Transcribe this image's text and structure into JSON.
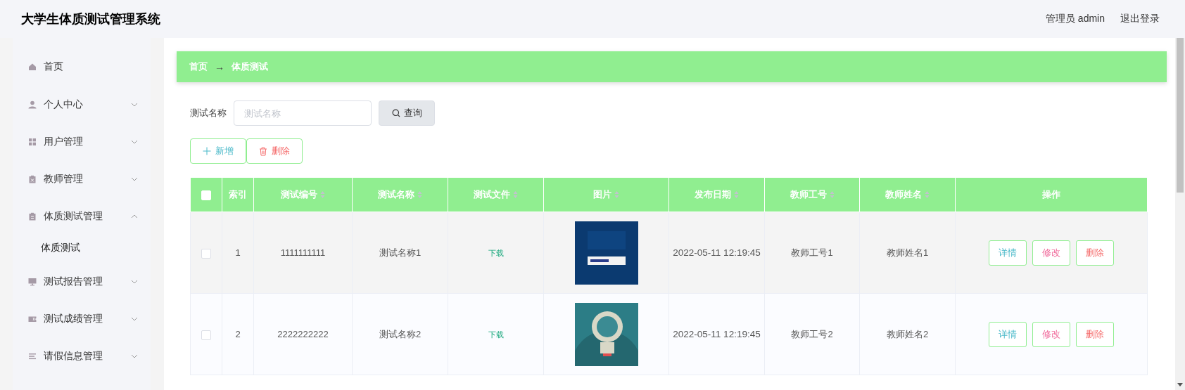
{
  "header": {
    "title": "大学生体质测试管理系统",
    "user": "管理员 admin",
    "logout": "退出登录"
  },
  "sidebar": {
    "items": [
      {
        "label": "首页"
      },
      {
        "label": "个人中心",
        "expanded": false
      },
      {
        "label": "用户管理",
        "expanded": false
      },
      {
        "label": "教师管理",
        "expanded": false
      },
      {
        "label": "体质测试管理",
        "expanded": true,
        "children": [
          {
            "label": "体质测试",
            "selected": true
          }
        ]
      },
      {
        "label": "测试报告管理",
        "expanded": false
      },
      {
        "label": "测试成绩管理",
        "expanded": false
      },
      {
        "label": "请假信息管理",
        "expanded": false
      }
    ]
  },
  "breadcrumb": {
    "items": [
      "首页",
      "体质测试"
    ],
    "separator": "→"
  },
  "search": {
    "label": "测试名称",
    "placeholder": "测试名称",
    "button": "查询"
  },
  "toolbar": [
    {
      "label": "新增",
      "kind": "add"
    },
    {
      "label": "删除",
      "kind": "delete"
    }
  ],
  "table": {
    "columns": [
      {
        "kind": "checkbox",
        "checked": false
      },
      {
        "label": "索引",
        "sortable": false
      },
      {
        "label": "测试编号",
        "sortable": true
      },
      {
        "label": "测试名称",
        "sortable": true
      },
      {
        "label": "测试文件",
        "sortable": true
      },
      {
        "label": "图片",
        "sortable": true
      },
      {
        "label": "发布日期",
        "sortable": true
      },
      {
        "label": "教师工号",
        "sortable": true
      },
      {
        "label": "教师姓名",
        "sortable": true
      },
      {
        "label": "操作",
        "sortable": false
      }
    ],
    "rows": [
      {
        "checked": false,
        "index": "1",
        "code": "1111111111",
        "name": "测试名称1",
        "file": "下载",
        "date": "2022-05-11 12:19:45",
        "teacher_id": "教师工号1",
        "teacher_name": "教师姓名1",
        "actions": [
          {
            "label": "详情",
            "kind": "detail"
          },
          {
            "label": "修改",
            "kind": "edit"
          },
          {
            "label": "删除",
            "kind": "delete"
          }
        ]
      },
      {
        "checked": false,
        "index": "2",
        "code": "2222222222",
        "name": "测试名称2",
        "file": "下载",
        "date": "2022-05-11 12:19:45",
        "teacher_id": "教师工号2",
        "teacher_name": "教师姓名2",
        "actions": [
          {
            "label": "详情",
            "kind": "detail"
          },
          {
            "label": "修改",
            "kind": "edit"
          },
          {
            "label": "删除",
            "kind": "delete"
          }
        ]
      }
    ]
  }
}
